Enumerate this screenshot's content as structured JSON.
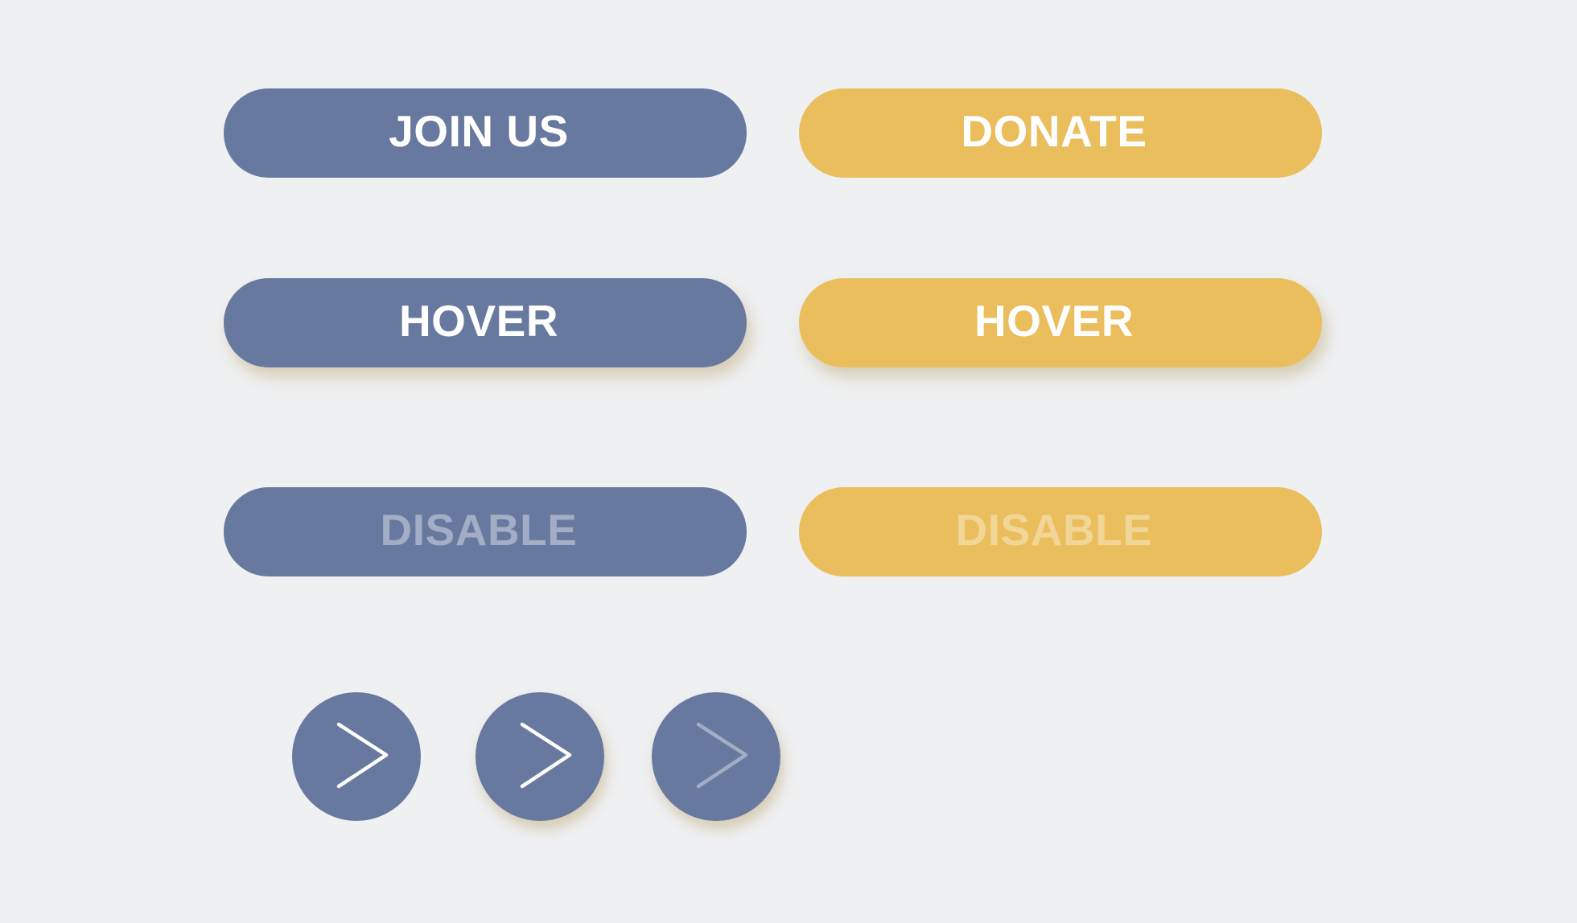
{
  "colors": {
    "background": "#eff0f2",
    "primary": "#6879a0",
    "secondary": "#eabe5d",
    "label": "#ffffff",
    "primary_disabled_label": "#a3adc5",
    "secondary_disabled_label": "#f1d698",
    "arrow": "#ffffff",
    "arrow_disabled": "#a3adc5"
  },
  "buttons": {
    "primary": {
      "default_label": "JOIN US",
      "hover_label": "HOVER",
      "disabled_label": "DISABLE"
    },
    "secondary": {
      "default_label": "DONATE",
      "hover_label": "HOVER",
      "disabled_label": "DISABLE"
    }
  },
  "arrow_buttons": [
    {
      "state": "default",
      "icon": "chevron-right-icon"
    },
    {
      "state": "hover",
      "icon": "chevron-right-icon"
    },
    {
      "state": "disabled",
      "icon": "chevron-right-icon"
    }
  ]
}
